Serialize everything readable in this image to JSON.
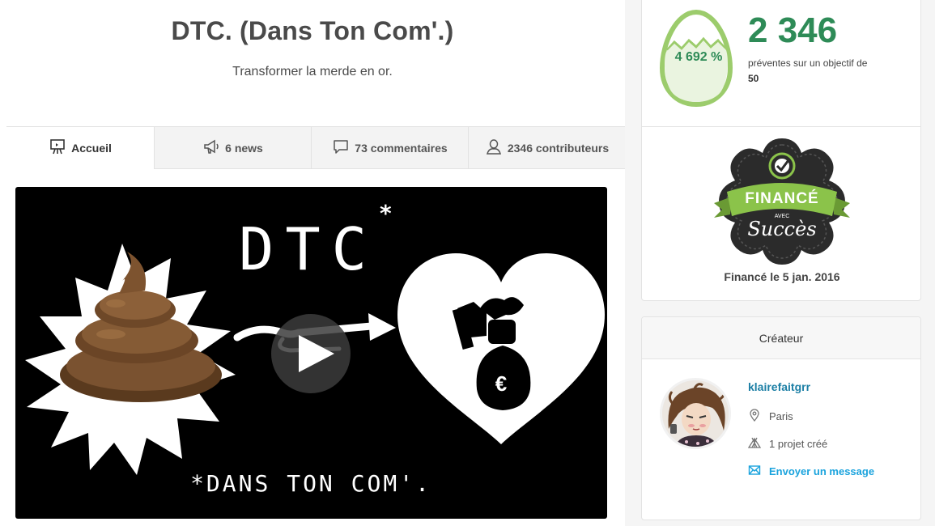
{
  "project": {
    "title": "DTC. (Dans Ton Com'.)",
    "subtitle": "Transformer la merde en or."
  },
  "tabs": [
    {
      "label": "Accueil",
      "icon": "easel-icon",
      "active": true
    },
    {
      "label": "6 news",
      "icon": "megaphone-icon",
      "active": false
    },
    {
      "label": "73 commentaires",
      "icon": "speech-bubble-icon",
      "active": false
    },
    {
      "label": "2346 contributeurs",
      "icon": "person-icon",
      "active": false
    }
  ],
  "video": {
    "title_text": "DTC",
    "title_mark": "*",
    "footnote": "*DANS TON COM'.",
    "currency_symbol": "€"
  },
  "funding": {
    "percent": "4 692 %",
    "count": "2 346",
    "description": "préventes sur un objectif de",
    "goal": "50",
    "badge_top": "FINANCÉ",
    "badge_small": "AVEC",
    "badge_bottom": "Succès",
    "funded_date": "Financé le 5 jan. 2016"
  },
  "creator": {
    "header": "Créateur",
    "name": "klairefaitgrr",
    "city": "Paris",
    "projects": "1 projet créé",
    "message": "Envoyer un message"
  },
  "colors": {
    "accent_green": "#2e8b57",
    "egg_green": "#9ccc6c",
    "link_blue": "#1aa3dd",
    "name_blue": "#1c7fa5",
    "badge_green": "#8bc34a"
  }
}
